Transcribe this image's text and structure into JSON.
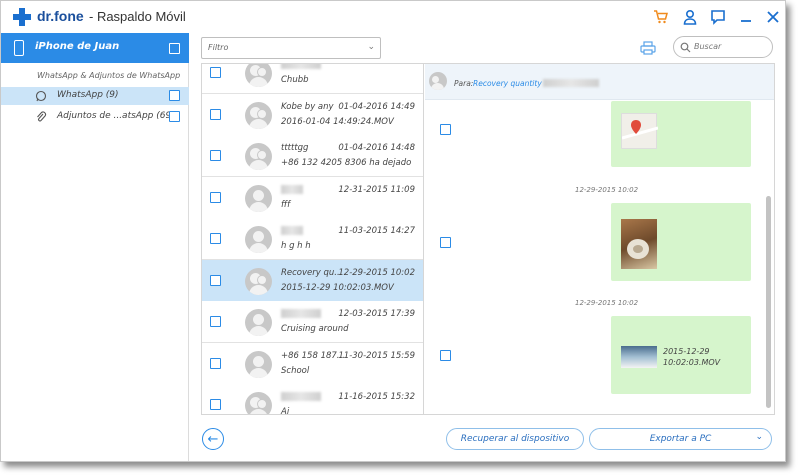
{
  "window": {
    "brand": "dr.fone",
    "title": "- Raspaldo Móvil"
  },
  "sidebar": {
    "device": "iPhone de Juan",
    "section_label": "WhatsApp & Adjuntos de WhatsApp",
    "items": [
      {
        "label": "WhatsApp (9)",
        "icon": "whatsapp-icon"
      },
      {
        "label": "Adjuntos de ...atsApp (69)",
        "icon": "paperclip-icon"
      }
    ]
  },
  "toolbar": {
    "filter_placeholder": "Filtro",
    "search_placeholder": "Buscar"
  },
  "conversations": [
    {
      "name": "",
      "date": "",
      "message": "Chubb",
      "group": true
    },
    {
      "name": "Kobe by any",
      "date": "01-04-2016 14:49",
      "message": "2016-01-04 14:49:24.MOV",
      "group": true
    },
    {
      "name": "tttttgg",
      "date": "01-04-2016 14:48",
      "message": "+86 132 4205 8306 ha dejado",
      "group": true
    },
    {
      "name": "",
      "date": "12-31-2015 11:09",
      "message": "fff",
      "group": false
    },
    {
      "name": "",
      "date": "11-03-2015 14:27",
      "message": "h g h h",
      "group": false
    },
    {
      "name": "Recovery qu...",
      "date": "12-29-2015 10:02",
      "message": "2015-12-29 10:02:03.MOV",
      "group": true,
      "selected": true
    },
    {
      "name": "",
      "date": "12-03-2015 17:39",
      "message": "Cruising around",
      "group": false
    },
    {
      "name": "+86 158 187...",
      "date": "11-30-2015 15:59",
      "message": "School",
      "group": false
    },
    {
      "name": "",
      "date": "11-16-2015 15:32",
      "message": "Aj",
      "group": true
    }
  ],
  "chat": {
    "to_label": "Para:",
    "to_value": "Recovery quantity",
    "timestamps": [
      "12-29-2015 10:02",
      "12-29-2015 10:02"
    ],
    "video_caption_line1": "2015-12-29",
    "video_caption_line2": "10:02:03.MOV"
  },
  "bottom": {
    "recover_label": "Recuperar al dispositivo",
    "export_label": "Exportar a PC"
  },
  "colors": {
    "accent": "#2b8be6",
    "selected": "#cbe4f8",
    "bubble": "#d6f5cc"
  }
}
